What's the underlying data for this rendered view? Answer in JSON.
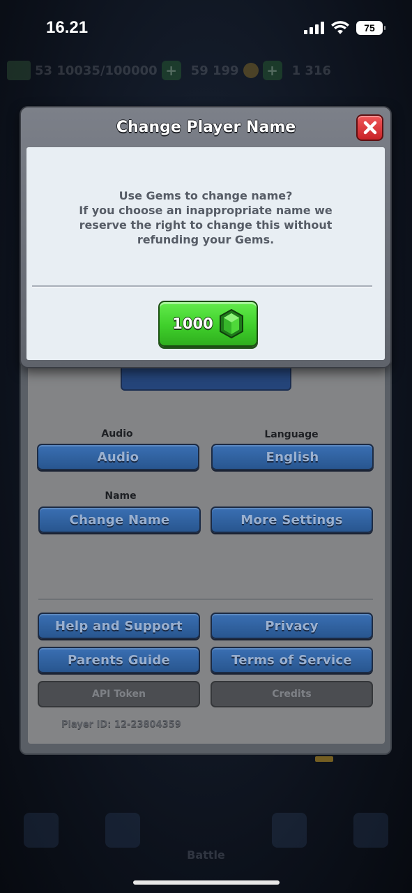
{
  "status_bar": {
    "time": "16.21",
    "battery": "75"
  },
  "resources": {
    "trophy_progress": "53 10035/100000",
    "gold": "59 199",
    "gems": "1 316"
  },
  "modal": {
    "title": "Change Player Name",
    "message_line1": "Use Gems to change name?",
    "message_line2": "If you choose an inappropriate name we",
    "message_line3": "reserve the right to change this without",
    "message_line4": "refunding your Gems.",
    "cost": "1000"
  },
  "settings": {
    "audio_label": "Audio",
    "audio_button": "Audio",
    "language_label": "Language",
    "language_button": "English",
    "name_label": "Name",
    "change_name_button": "Change Name",
    "more_settings_button": "More Settings",
    "help_button": "Help and Support",
    "privacy_button": "Privacy",
    "parents_guide_button": "Parents Guide",
    "terms_button": "Terms of Service",
    "api_token_button": "API Token",
    "credits_button": "Credits",
    "player_id": "Player ID: 12-23804359"
  },
  "nav": {
    "battle_label": "Battle"
  }
}
